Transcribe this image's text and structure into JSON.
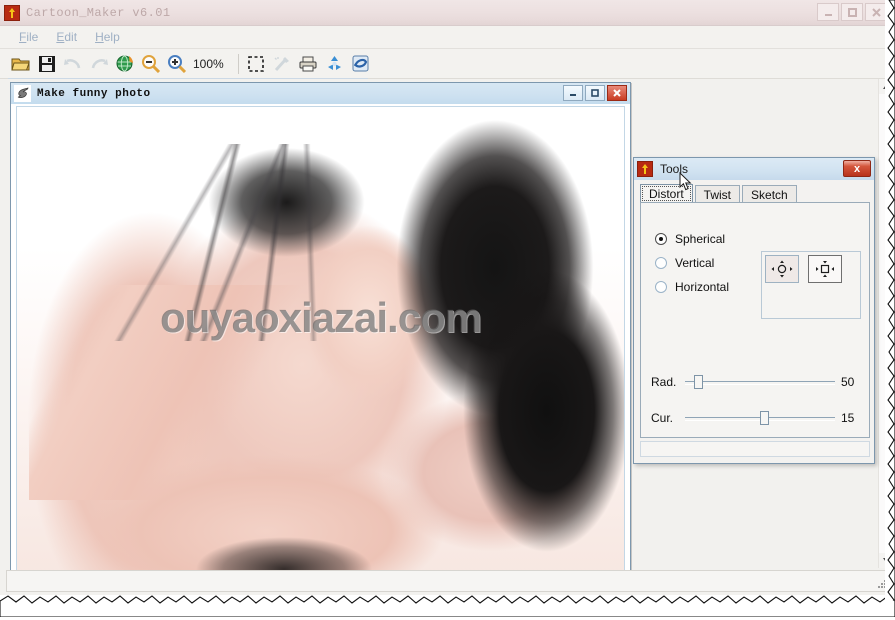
{
  "window": {
    "title": "Cartoon_Maker v6.01",
    "icon": "app-arrow-icon",
    "buttons": {
      "minimize": "minimize-icon",
      "maximize": "maximize-icon",
      "close": "close-icon"
    }
  },
  "menu": {
    "items": [
      {
        "accel": "F",
        "rest": "ile"
      },
      {
        "accel": "E",
        "rest": "dit"
      },
      {
        "accel": "H",
        "rest": "elp"
      }
    ]
  },
  "toolbar": {
    "zoom_level": "100%",
    "buttons": [
      {
        "name": "open-icon",
        "enabled": true
      },
      {
        "name": "save-icon",
        "enabled": true
      },
      {
        "name": "undo-icon",
        "enabled": false
      },
      {
        "name": "redo-icon",
        "enabled": false
      },
      {
        "name": "refresh-globe-icon",
        "enabled": true
      },
      {
        "name": "zoom-out-icon",
        "enabled": true
      },
      {
        "name": "zoom-in-icon",
        "enabled": true
      },
      {
        "name": "select-region-icon",
        "enabled": true
      },
      {
        "name": "magic-wand-icon",
        "enabled": false
      },
      {
        "name": "print-icon",
        "enabled": true
      },
      {
        "name": "recycle-icon",
        "enabled": true
      },
      {
        "name": "internet-icon",
        "enabled": true
      }
    ]
  },
  "photo_window": {
    "title": "Make funny photo",
    "icon": "dragon-icon",
    "buttons": {
      "minimize": "minimize-icon",
      "maximize": "maximize-icon",
      "close": "close-icon"
    },
    "watermark": "ouyaoxiazai.com"
  },
  "tools_dialog": {
    "title": "Tools",
    "icon": "app-arrow-icon",
    "close_label": "x",
    "tabs": [
      {
        "label": "Distort",
        "active": true
      },
      {
        "label": "Twist",
        "active": false
      },
      {
        "label": "Sketch",
        "active": false
      }
    ],
    "radios": [
      {
        "label": "Spherical",
        "checked": true
      },
      {
        "label": "Vertical",
        "checked": false
      },
      {
        "label": "Horizontal",
        "checked": false
      }
    ],
    "mode_buttons": [
      {
        "name": "distort-outward-icon",
        "pressed": true
      },
      {
        "name": "distort-inward-icon",
        "pressed": false
      }
    ],
    "sliders": [
      {
        "label": "Rad.",
        "value": "50",
        "percent": 6
      },
      {
        "label": "Cur.",
        "value": "15",
        "percent": 50
      }
    ]
  },
  "status_bar": {
    "text": ""
  },
  "colors": {
    "titlebar_faded": "#ede1e1",
    "mdi_titlebar": "#cfe2f1",
    "close_red": "#c93c23",
    "accent_blue": "#7d97ad",
    "watermark_gray": "#696969"
  }
}
